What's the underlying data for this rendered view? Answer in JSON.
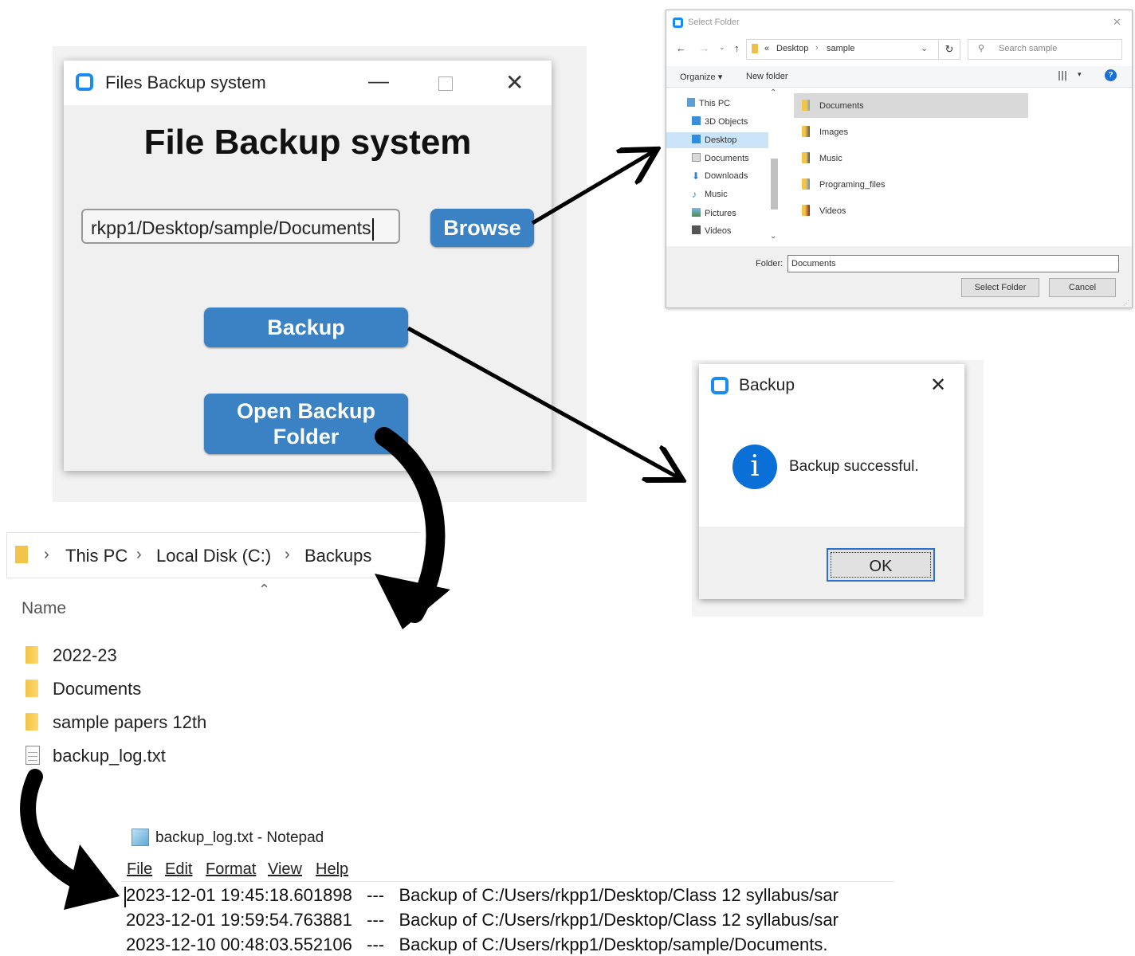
{
  "app": {
    "window_title": "Files Backup system",
    "heading": "File Backup system",
    "path_value": "rkpp1/Desktop/sample/Documents",
    "browse_label": "Browse",
    "backup_label": "Backup",
    "open_folder_line1": "Open Backup",
    "open_folder_line2": "Folder"
  },
  "select_folder": {
    "title": "Select Folder",
    "crumb_prefix": "«",
    "crumb_desktop": "Desktop",
    "crumb_sample": "sample",
    "search_placeholder": "Search sample",
    "organize_label": "Organize ▾",
    "new_folder_label": "New folder",
    "nav": [
      "This PC",
      "3D Objects",
      "Desktop",
      "Documents",
      "Downloads",
      "Music",
      "Pictures",
      "Videos"
    ],
    "files": [
      "Documents",
      "Images",
      "Music",
      "Programing_files",
      "Videos"
    ],
    "folder_label": "Folder:",
    "folder_value": "Documents",
    "select_button": "Select Folder",
    "cancel_button": "Cancel",
    "accent_color": "#0078d7"
  },
  "message_box": {
    "title": "Backup",
    "message": "Backup successful.",
    "ok_label": "OK"
  },
  "explorer": {
    "breadcrumb": [
      "This PC",
      "Local Disk (C:)",
      "Backups"
    ],
    "column_name": "Name",
    "items": [
      "2022-23",
      "Documents",
      "sample papers 12th",
      "backup_log.txt"
    ]
  },
  "notepad": {
    "title": "backup_log.txt - Notepad",
    "menu": [
      "File",
      "Edit",
      "Format",
      "View",
      "Help"
    ],
    "lines": [
      "2023-12-01 19:45:18.601898   ---   Backup of C:/Users/rkpp1/Desktop/Class 12 syllabus/sar",
      "2023-12-01 19:59:54.763881   ---   Backup of C:/Users/rkpp1/Desktop/Class 12 syllabus/sar",
      "2023-12-10 00:48:03.552106   ---   Backup of C:/Users/rkpp1/Desktop/sample/Documents."
    ]
  },
  "colors": {
    "button_blue": "#3a82c4",
    "info_blue": "#0a6fd6"
  }
}
